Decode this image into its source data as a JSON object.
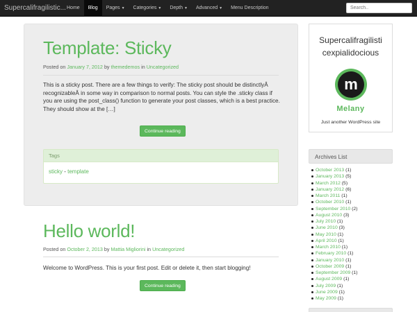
{
  "nav": {
    "brand": "Supercalifragilistic...",
    "items": [
      {
        "label": "Home",
        "dropdown": false,
        "active": false
      },
      {
        "label": "Blog",
        "dropdown": false,
        "active": true
      },
      {
        "label": "Pages",
        "dropdown": true,
        "active": false
      },
      {
        "label": "Categories",
        "dropdown": true,
        "active": false
      },
      {
        "label": "Depth",
        "dropdown": true,
        "active": false
      },
      {
        "label": "Advanced",
        "dropdown": true,
        "active": false
      },
      {
        "label": "Menu Description",
        "dropdown": false,
        "active": false
      }
    ],
    "search_placeholder": "Search..",
    "caret_icon": "caret-down-icon"
  },
  "posts": [
    {
      "title": "Template: Sticky",
      "meta": {
        "posted_on": "Posted on",
        "date": "January 7, 2012",
        "by": "by",
        "author": "themedemos",
        "in": "in",
        "category": "Uncategorized"
      },
      "excerpt": "This is a sticky post. There are a few things to verify: The sticky post should be distinctlyÂ recognizableÂ in some way in comparison to normal posts. You can style the .sticky class if you are using the post_class() function to generate your post classes, which is a best practice. They should show at the […]",
      "button": "Continue reading",
      "tags": {
        "heading": "Tags",
        "items": [
          "sticky",
          "template"
        ],
        "separator": " - "
      }
    },
    {
      "title": "Hello world!",
      "meta": {
        "posted_on": "Posted on",
        "date": "October 2, 2013",
        "by": "by",
        "author": "Mattia Migliorini",
        "in": "in",
        "category": "Uncategorized"
      },
      "excerpt": "Welcome to WordPress. This is your first post. Edit or delete it, then start blogging!",
      "button": "Continue reading"
    }
  ],
  "sidebar": {
    "site_title": "Supercalifragilisti cexpialidocious",
    "logo_letter": "m",
    "logo_name": "Melany",
    "tagline": "Just another WordPress site",
    "archives": {
      "heading": "Archives List",
      "items": [
        {
          "label": "October 2013",
          "count": "(1)"
        },
        {
          "label": "January 2013",
          "count": "(5)"
        },
        {
          "label": "March 2012",
          "count": "(5)"
        },
        {
          "label": "January 2012",
          "count": "(6)"
        },
        {
          "label": "March 2011",
          "count": "(1)"
        },
        {
          "label": "October 2010",
          "count": "(1)"
        },
        {
          "label": "September 2010",
          "count": "(2)"
        },
        {
          "label": "August 2010",
          "count": "(3)"
        },
        {
          "label": "July 2010",
          "count": "(1)"
        },
        {
          "label": "June 2010",
          "count": "(3)"
        },
        {
          "label": "May 2010",
          "count": "(1)"
        },
        {
          "label": "April 2010",
          "count": "(1)"
        },
        {
          "label": "March 2010",
          "count": "(1)"
        },
        {
          "label": "February 2010",
          "count": "(1)"
        },
        {
          "label": "January 2010",
          "count": "(1)"
        },
        {
          "label": "October 2009",
          "count": "(1)"
        },
        {
          "label": "September 2009",
          "count": "(1)"
        },
        {
          "label": "August 2009",
          "count": "(1)"
        },
        {
          "label": "July 2009",
          "count": "(1)"
        },
        {
          "label": "June 2009",
          "count": "(1)"
        },
        {
          "label": "May 2009",
          "count": "(1)"
        }
      ]
    }
  },
  "colors": {
    "accent": "#5cb85c",
    "navbar": "#222222",
    "sticky_background": "#ededed"
  }
}
